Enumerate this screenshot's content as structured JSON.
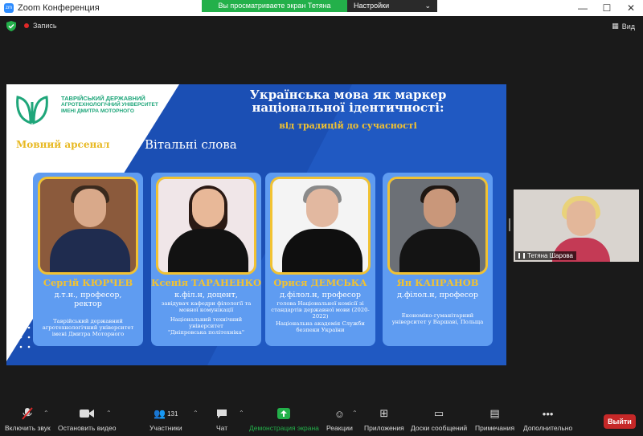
{
  "window": {
    "title": "Zoom Конференция",
    "app_icon_text": "zm"
  },
  "share_banner": {
    "message": "Вы просматриваете экран Тетяна Шарова",
    "options_label": "Настройки просмотра"
  },
  "topbar": {
    "recording_label": "Запись",
    "view_label": "Вид"
  },
  "slide": {
    "logo_text_1": "ТАВРІЙСЬКИЙ ДЕРЖАВНИЙ",
    "logo_text_2": "АГРОТЕХНОЛОГІЧНИЙ УНІВЕРСИТЕТ",
    "logo_text_3": "ІМЕНІ ДМИТРА МОТОРНОГО",
    "arsenal": "Мовний арсенал",
    "headline_1": "Українська мова як маркер",
    "headline_2": "національної ідентичності:",
    "subhead": "від традицій до сучасності",
    "welcome": "Вітальні слова",
    "speakers": [
      {
        "name": "Сергій КЮРЧЕВ",
        "degree_1": "д.т.н., професор,",
        "degree_2": "ректор",
        "role": "",
        "affiliation_1": "Таврійський державний",
        "affiliation_2": "агротехнологічний університет",
        "affiliation_3": "імені Дмитра Моторного"
      },
      {
        "name": "Ксенія ТАРАНЕНКО",
        "degree_1": "к.філ.н, доцент,",
        "degree_2": "",
        "role": "завідувач кафедри філології та мовної комунікації",
        "affiliation_1": "Національний технічний",
        "affiliation_2": "університет",
        "affiliation_3": "\"Дніпровська політехніка\""
      },
      {
        "name": "Орися ДЕМСЬКА",
        "degree_1": "д.філол.н, професор",
        "degree_2": "",
        "role": "голова Національної комісії зі стандартів державної мови (2020-2022)",
        "affiliation_1": "Національна академія Служби",
        "affiliation_2": "безпеки України",
        "affiliation_3": ""
      },
      {
        "name": "Ян КАПРАНОВ",
        "degree_1": "д.філол.н, професор",
        "degree_2": "",
        "role": "",
        "affiliation_1": "Економіко-гуманітарний",
        "affiliation_2": "університет у Варшаві, Польща",
        "affiliation_3": ""
      }
    ]
  },
  "participant_video": {
    "name": "Тетяна Шарова"
  },
  "toolbar": {
    "mute_label": "Включить звук",
    "video_label": "Остановить видео",
    "participants_label": "Участники",
    "participants_count": "131",
    "chat_label": "Чат",
    "share_label": "Демонстрация экрана",
    "reactions_label": "Реакции",
    "apps_label": "Приложения",
    "whiteboards_label": "Доски сообщений",
    "notes_label": "Примечания",
    "more_label": "Дополнительно",
    "leave_label": "Выйти"
  },
  "colors": {
    "accent_green": "#23b04a",
    "slide_blue": "#1b4fb4",
    "gold": "#f2c230",
    "leave_red": "#c62828"
  }
}
